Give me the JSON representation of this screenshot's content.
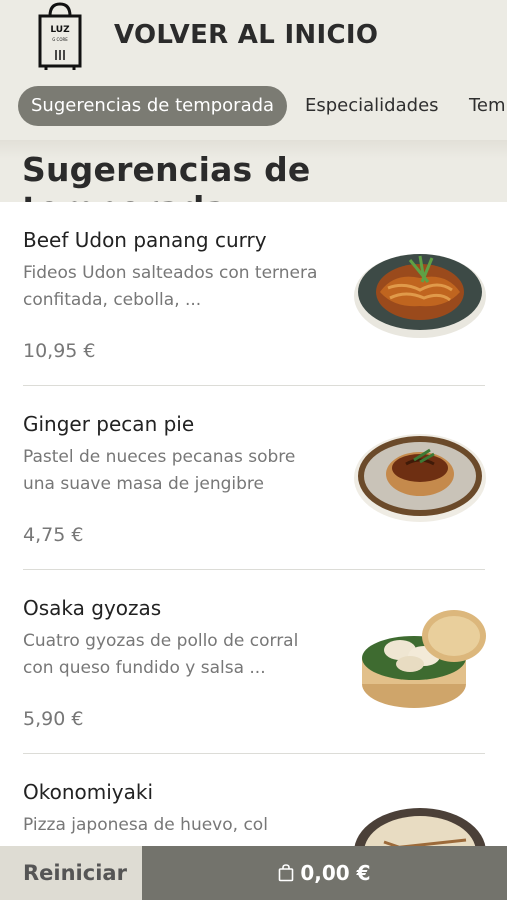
{
  "header": {
    "logo_text": "LUZ",
    "logo_sub": "G CORE",
    "back_label": "VOLVER AL INICIO"
  },
  "tabs": [
    {
      "label": "Sugerencias de temporada",
      "active": true
    },
    {
      "label": "Especialidades",
      "active": false
    },
    {
      "label": "Tem",
      "active": false
    }
  ],
  "section": {
    "title": "Sugerencias de temporada"
  },
  "items": [
    {
      "name": "Beef Udon panang curry",
      "desc": "Fideos Udon salteados con ternera confitada, cebolla, ...",
      "price": "10,95 €"
    },
    {
      "name": "Ginger pecan pie",
      "desc": "Pastel de nueces pecanas sobre una suave masa de jengibre",
      "price": "4,75 €"
    },
    {
      "name": "Osaka gyozas",
      "desc": "Cuatro gyozas de pollo de corral con queso fundido y salsa ...",
      "price": "5,90 €"
    },
    {
      "name": "Okonomiyaki",
      "desc": "Pizza japonesa de huevo, col",
      "price": ""
    }
  ],
  "footer": {
    "reset_label": "Reiniciar",
    "cart_total": "0,00 €",
    "cart_icon": "shopping-bag-icon"
  },
  "colors": {
    "background": "#ecebe4",
    "active_tab": "#7b7b73",
    "cart_button": "#73736c",
    "reset_button": "#dedcd3"
  }
}
